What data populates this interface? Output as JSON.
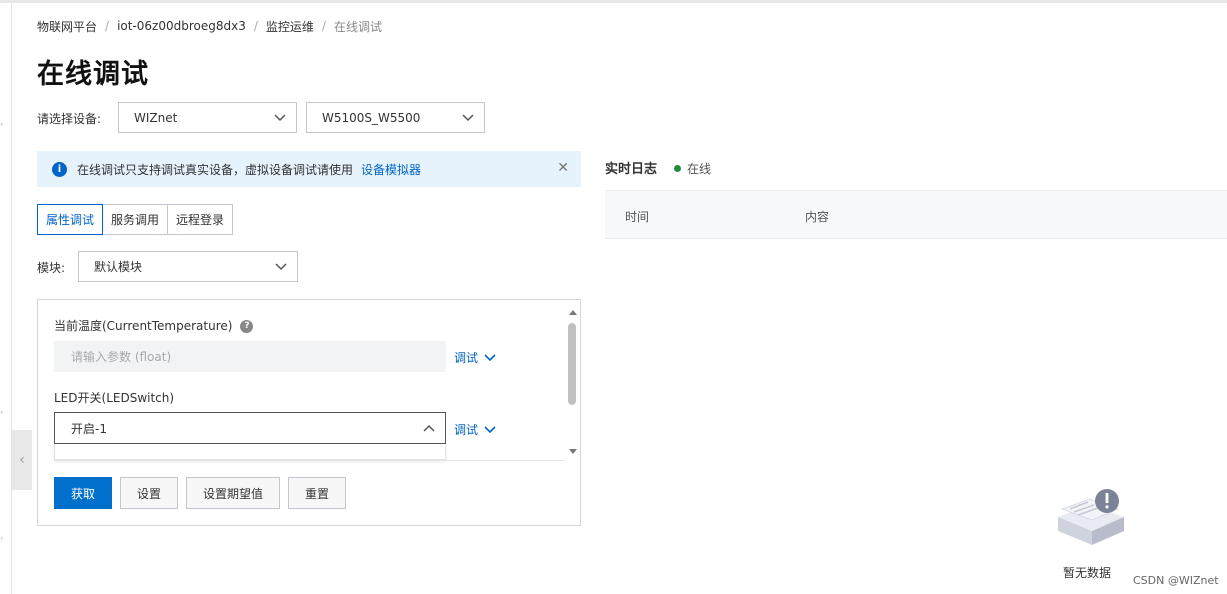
{
  "breadcrumb": {
    "items": [
      "物联网平台",
      "iot-06z00dbroeg8dx3",
      "监控运维",
      "在线调试"
    ],
    "separator": "/"
  },
  "page": {
    "title": "在线调试"
  },
  "device_select": {
    "label": "请选择设备:",
    "product": "WIZnet",
    "device": "W5100S_W5500"
  },
  "notice": {
    "text": "在线调试只支持调试真实设备，虚拟设备调试请使用",
    "link": "设备模拟器",
    "close": "✕"
  },
  "tabs": [
    {
      "label": "属性调试",
      "active": true
    },
    {
      "label": "服务调用",
      "active": false
    },
    {
      "label": "远程登录",
      "active": false
    }
  ],
  "module": {
    "label": "模块:",
    "value": "默认模块"
  },
  "properties": {
    "temp": {
      "label": "当前温度(CurrentTemperature)",
      "help": "?",
      "placeholder": "请输入参数 (float)",
      "debug": "调试"
    },
    "led": {
      "label": "LED开关(LEDSwitch)",
      "value": "开启-1",
      "debug": "调试"
    }
  },
  "buttons": {
    "get": "获取",
    "set": "设置",
    "set_expected": "设置期望值",
    "reset": "重置"
  },
  "log": {
    "title": "实时日志",
    "status": "在线",
    "status_color": "#1e8e3e",
    "col_time": "时间",
    "col_content": "内容",
    "empty": "暂无数据"
  },
  "watermark": "CSDN @WIZnet",
  "colors": {
    "accent": "#0064c8",
    "primary_button": "#0070cc",
    "notice_bg": "#e6f3fd"
  }
}
